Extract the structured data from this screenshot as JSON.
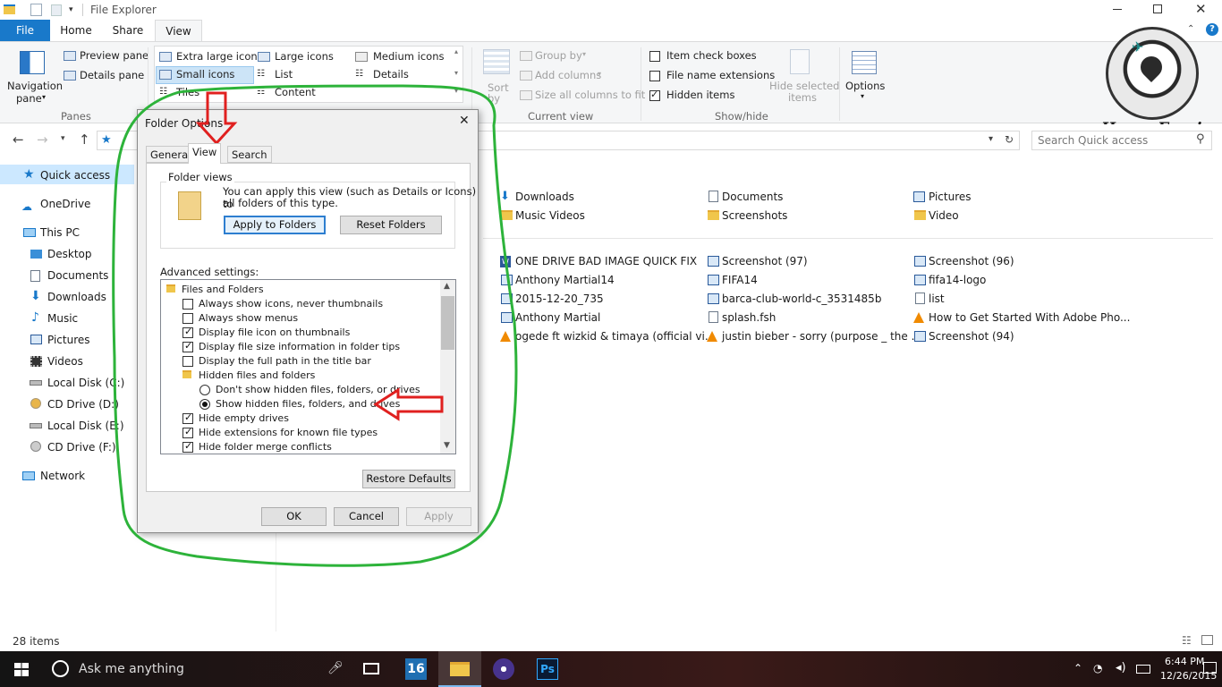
{
  "window": {
    "title": "File Explorer"
  },
  "tabs": {
    "file": "File",
    "home": "Home",
    "share": "Share",
    "view": "View"
  },
  "ribbon": {
    "panes": {
      "navigation_pane": "Navigation",
      "navigation_pane_2": "pane",
      "preview_pane": "Preview pane",
      "details_pane": "Details pane",
      "group": "Panes"
    },
    "layout": {
      "extra_large": "Extra large icons",
      "large": "Large icons",
      "medium": "Medium icons",
      "small": "Small icons",
      "list": "List",
      "details": "Details",
      "tiles": "Tiles",
      "content": "Content"
    },
    "current_view": {
      "sort": "Sort",
      "sort_by": "by",
      "group_by": "Group by",
      "add_columns": "Add columns",
      "size_columns": "Size all columns to fit",
      "group": "Current view"
    },
    "show_hide": {
      "item_check_boxes": "Item check boxes",
      "file_name_extensions": "File name extensions",
      "hidden_items": "Hidden items",
      "hide_selected": "Hide selected",
      "hide_selected_2": "items",
      "group": "Show/hide"
    },
    "options": "Options"
  },
  "watermark": "Hams_Empire",
  "address": {
    "search_placeholder": "Search Quick access"
  },
  "nav": {
    "quick_access": "Quick access",
    "onedrive": "OneDrive",
    "this_pc": "This PC",
    "desktop": "Desktop",
    "documents": "Documents",
    "downloads": "Downloads",
    "music": "Music",
    "pictures": "Pictures",
    "videos": "Videos",
    "local_c": "Local Disk (C:)",
    "cd_d": "CD Drive (D:)",
    "local_e": "Local Disk (E:)",
    "cd_f": "CD Drive (F:)",
    "network": "Network"
  },
  "folders": [
    {
      "name": "Downloads"
    },
    {
      "name": "Documents"
    },
    {
      "name": "Pictures"
    },
    {
      "name": "Music Videos"
    },
    {
      "name": "Screenshots"
    },
    {
      "name": "Video"
    }
  ],
  "recent": [
    {
      "name": "ONE DRIVE BAD IMAGE QUICK FIX"
    },
    {
      "name": "Screenshot (97)"
    },
    {
      "name": "Screenshot (96)"
    },
    {
      "name": "Anthony Martial14"
    },
    {
      "name": "FIFA14"
    },
    {
      "name": "fifa14-logo"
    },
    {
      "name": "2015-12-20_735"
    },
    {
      "name": "barca-club-world-c_3531485b"
    },
    {
      "name": "list"
    },
    {
      "name": "Anthony Martial"
    },
    {
      "name": "splash.fsh"
    },
    {
      "name": "How to Get Started With Adobe Pho..."
    },
    {
      "name": "ogede ft wizkid & timaya (official vi..."
    },
    {
      "name": "justin bieber - sorry (purpose _ the ..."
    },
    {
      "name": "Screenshot (94)"
    }
  ],
  "status": {
    "items": "28 items"
  },
  "dialog": {
    "title": "Folder Options",
    "tabs": {
      "general": "General",
      "view": "View",
      "search": "Search"
    },
    "folder_views": "Folder views",
    "folder_views_text_1": "You can apply this view (such as Details or Icons) to",
    "folder_views_text_2": "all folders of this type.",
    "apply_to_folders": "Apply to Folders",
    "reset_folders": "Reset Folders",
    "advanced_settings": "Advanced settings:",
    "advanced": [
      {
        "label": "Files and Folders",
        "kind": "folder"
      },
      {
        "label": "Always show icons, never thumbnails",
        "kind": "check",
        "checked": false
      },
      {
        "label": "Always show menus",
        "kind": "check",
        "checked": false
      },
      {
        "label": "Display file icon on thumbnails",
        "kind": "check",
        "checked": true
      },
      {
        "label": "Display file size information in folder tips",
        "kind": "check",
        "checked": true
      },
      {
        "label": "Display the full path in the title bar",
        "kind": "check",
        "checked": false
      },
      {
        "label": "Hidden files and folders",
        "kind": "folder"
      },
      {
        "label": "Don't show hidden files, folders, or drives",
        "kind": "radio",
        "checked": false
      },
      {
        "label": "Show hidden files, folders, and drives",
        "kind": "radio",
        "checked": true
      },
      {
        "label": "Hide empty drives",
        "kind": "check",
        "checked": true
      },
      {
        "label": "Hide extensions for known file types",
        "kind": "check",
        "checked": true
      },
      {
        "label": "Hide folder merge conflicts",
        "kind": "check",
        "checked": true
      }
    ],
    "restore_defaults": "Restore Defaults",
    "ok": "OK",
    "cancel": "Cancel",
    "apply": "Apply"
  },
  "taskbar": {
    "search": "Ask me anything",
    "time": "6:44 PM",
    "date": "12/26/2015",
    "app_16": "16",
    "app_ps": "Ps"
  },
  "colors": {
    "accent": "#1979ca",
    "annotation_green": "#2db33a",
    "annotation_red": "#e0201f"
  }
}
